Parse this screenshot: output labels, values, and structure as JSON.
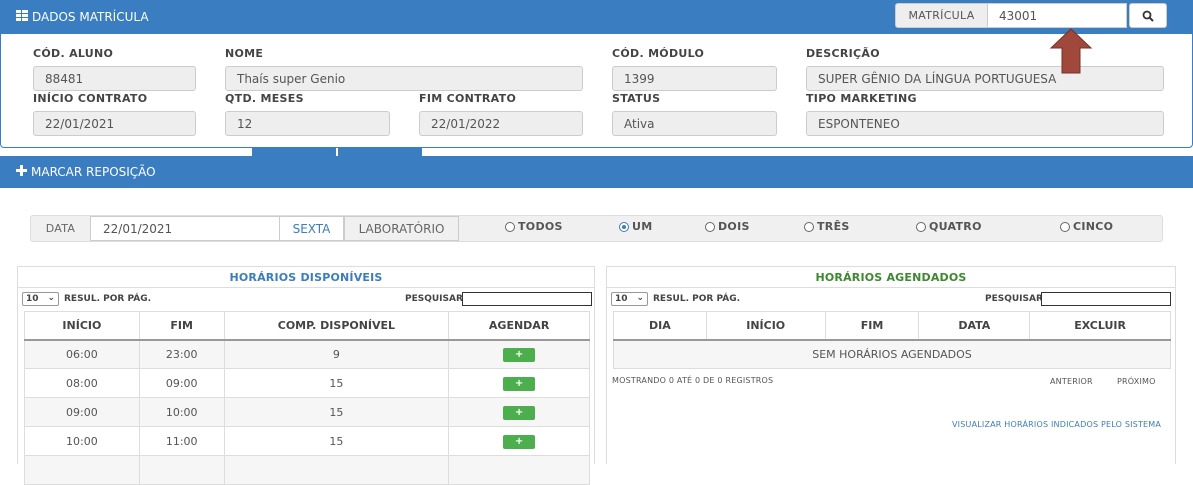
{
  "dados": {
    "title": "DADOS MATRÍCULA",
    "matricula_label": "MATRÍCULA",
    "matricula_value": "43001",
    "fields": {
      "cod_aluno": {
        "label": "CÓD. ALUNO",
        "value": "88481"
      },
      "nome": {
        "label": "NOME",
        "value": "Thaís super Genio"
      },
      "cod_modulo": {
        "label": "CÓD. MÓDULO",
        "value": "1399"
      },
      "descricao": {
        "label": "DESCRIÇÃO",
        "value": "SUPER GÊNIO DA LÍNGUA PORTUGUESA"
      },
      "inicio": {
        "label": "INÍCIO CONTRATO",
        "value": "22/01/2021"
      },
      "qtd_meses": {
        "label": "QTD. MESES",
        "value": "12"
      },
      "fim": {
        "label": "FIM CONTRATO",
        "value": "22/01/2022"
      },
      "status": {
        "label": "STATUS",
        "value": "Ativa"
      },
      "tipo_marketing": {
        "label": "TIPO MARKETING",
        "value": "ESPONTENEO"
      }
    }
  },
  "reposicao": {
    "title": "MARCAR REPOSIÇÃO",
    "data_label": "DATA",
    "data_value": "22/01/2021",
    "day": "SEXTA",
    "lab_label": "LABORATÓRIO",
    "options": [
      "TODOS",
      "UM",
      "DOIS",
      "TRÊS",
      "QUATRO",
      "CINCO"
    ],
    "selected_option": "UM"
  },
  "disponiveis": {
    "title": "HORÁRIOS DISPONÍVEIS",
    "page_size": "10",
    "rpp_label": "RESUL. POR PÁG.",
    "search_label": "PESQUISAR",
    "columns": [
      "INÍCIO",
      "FIM",
      "COMP. DISPONÍVEL",
      "AGENDAR"
    ],
    "add_label": "+",
    "rows": [
      [
        "06:00",
        "23:00",
        "9"
      ],
      [
        "08:00",
        "09:00",
        "15"
      ],
      [
        "09:00",
        "10:00",
        "15"
      ],
      [
        "10:00",
        "11:00",
        "15"
      ]
    ]
  },
  "agendados": {
    "title": "HORÁRIOS AGENDADOS",
    "page_size": "10",
    "rpp_label": "RESUL. POR PÁG.",
    "search_label": "PESQUISAR",
    "columns": [
      "DIA",
      "INÍCIO",
      "FIM",
      "DATA",
      "EXCLUIR"
    ],
    "empty": "SEM HORÁRIOS AGENDADOS",
    "info": "MOSTRANDO 0 ATÉ 0 DE 0 REGISTROS",
    "prev": "ANTERIOR",
    "next": "PRÓXIMO",
    "link": "VISUALIZAR HORÁRIOS INDICADOS PELO SISTEMA"
  },
  "colors": {
    "primary": "#3a7dc0",
    "success": "#4cae4c",
    "agendados_title": "#3c8a2e",
    "arrow": "#a0483c"
  }
}
